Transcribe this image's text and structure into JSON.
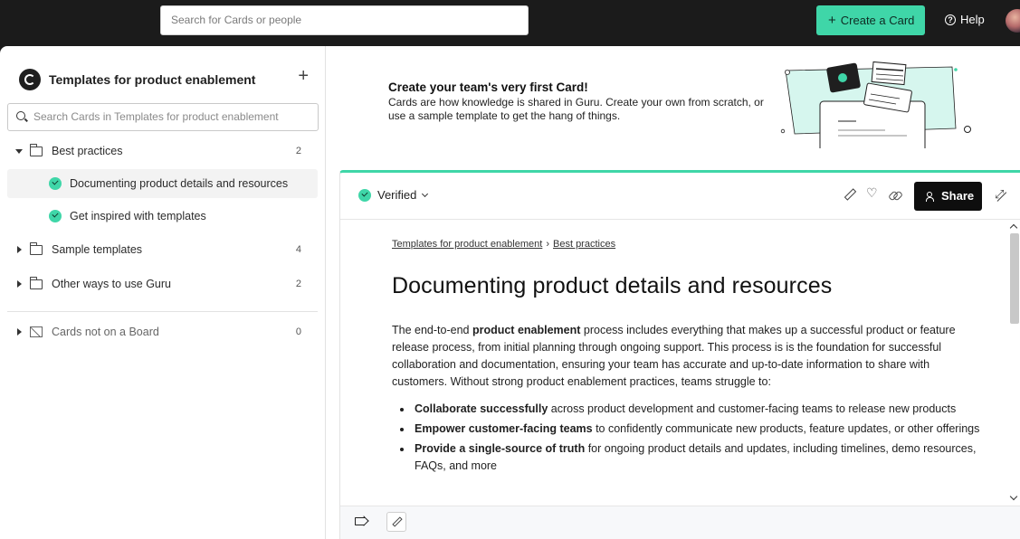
{
  "topbar": {
    "search_placeholder": "Search for Cards or people",
    "create_label": "Create a Card",
    "help_label": "Help"
  },
  "sidebar": {
    "board_title": "Templates for product enablement",
    "search_placeholder": "Search Cards in Templates for product enablement",
    "items": [
      {
        "label": "Best practices",
        "count": "2",
        "type": "folder",
        "expanded": true
      },
      {
        "label": "Documenting product details and resources",
        "type": "card",
        "active": true
      },
      {
        "label": "Get inspired with templates",
        "type": "card"
      },
      {
        "label": "Sample templates",
        "count": "4",
        "type": "folder"
      },
      {
        "label": "Other ways to use Guru",
        "count": "2",
        "type": "folder"
      },
      {
        "label": "Cards not on a Board",
        "count": "0",
        "type": "unboarded"
      }
    ]
  },
  "promo": {
    "title": "Create your team's very first Card!",
    "body": "Cards are how knowledge is shared in Guru. Create your own from scratch, or use a sample template to get the hang of things."
  },
  "card": {
    "status": "Verified",
    "share_label": "Share",
    "breadcrumb": [
      "Templates for product enablement",
      "Best practices"
    ],
    "breadcrumb_sep": "›",
    "title": "Documenting product details and resources",
    "paragraph": {
      "pre": "The end-to-end ",
      "bold": "product enablement",
      "post": " process includes everything that makes up a successful product or feature release process, from initial planning through ongoing support. This process is is the foundation for successful collaboration and documentation, ensuring your team has accurate and up-to-date information to share with customers. Without strong product enablement practices, teams struggle to:"
    },
    "bullets": [
      {
        "bold": "Collaborate successfully",
        "text": " across product development and customer-facing teams to release new products"
      },
      {
        "bold": "Empower customer-facing teams",
        "text": " to confidently communicate new products, feature updates, or other offerings"
      },
      {
        "bold": "Provide a single-source of truth",
        "text": " for ongoing product details and updates, including timelines, demo resources, FAQs, and more"
      }
    ]
  },
  "colors": {
    "accent": "#3fd6a8",
    "topbar": "#1b1b1b",
    "share": "#0e0e0e"
  },
  "icons": [
    "plus-icon",
    "help-icon",
    "search-icon",
    "folder-icon",
    "check-circle-icon",
    "pencil-icon",
    "heart-icon",
    "link-icon",
    "people-icon",
    "expand-icon",
    "tag-icon"
  ]
}
